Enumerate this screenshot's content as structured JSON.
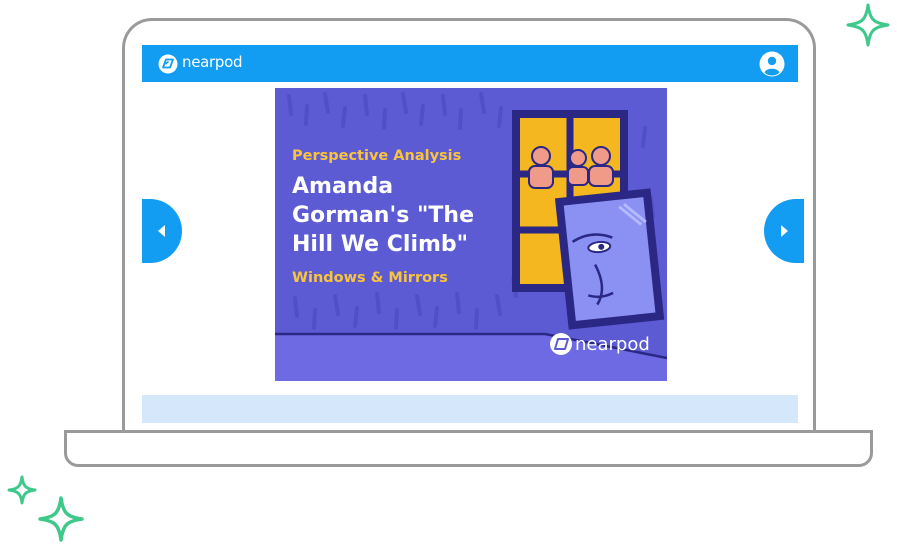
{
  "app": {
    "brand": "nearpod",
    "brand_color": "#129df2"
  },
  "header": {
    "logo_label": "nearpod",
    "user_icon": "user-avatar-icon"
  },
  "navigation": {
    "prev_icon": "chevron-left-icon",
    "next_icon": "chevron-right-icon"
  },
  "slide": {
    "kicker": "Perspective Analysis",
    "title_lines": [
      "Amanda",
      "Gorman's \"The",
      "Hill We Climb\""
    ],
    "subtitle": "Windows & Mirrors",
    "watermark_brand": "nearpod",
    "colors": {
      "background": "#5c5bd4",
      "title": "#ffffff",
      "accent": "#f9c43b"
    }
  }
}
